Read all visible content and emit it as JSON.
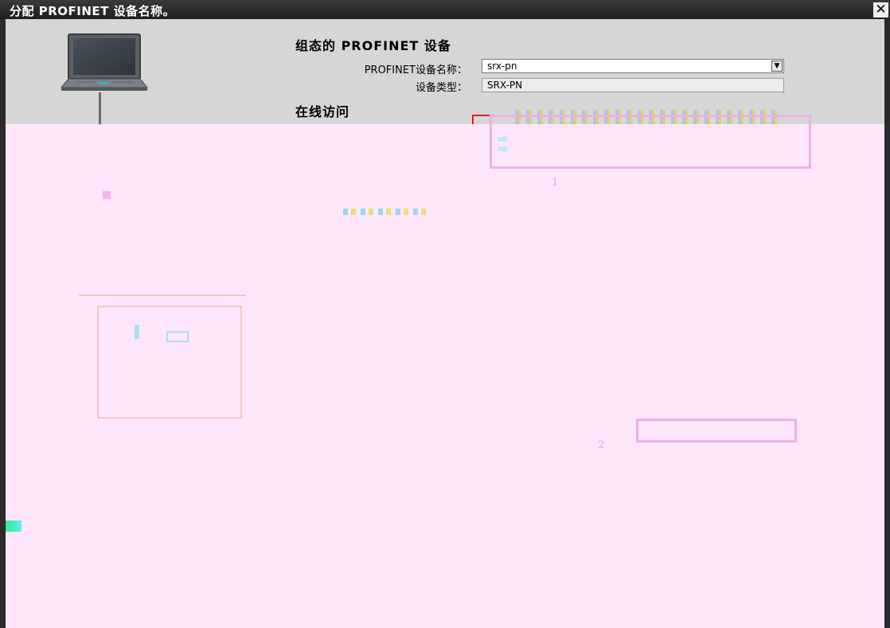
{
  "dialog": {
    "title": "分配 PROFINET 设备名称。",
    "close_glyph": "✕"
  },
  "configured_device": {
    "heading": "组态的 PROFINET 设备",
    "name_label": "PROFINET设备名称：",
    "name_value": "srx-pn",
    "type_label": "设备类型：",
    "type_value": "SRX-PN"
  },
  "online_access": {
    "heading": "在线访问"
  },
  "callouts": [
    "1",
    "2"
  ],
  "icons": {
    "pc": "laptop-icon",
    "dropdown": "chevron-down-icon",
    "close": "close-icon"
  },
  "colors": {
    "title_bar": "#2a2a2a",
    "panel": "#d6d6d6",
    "highlight": "#e02020",
    "overlay": "#ffe6fb"
  }
}
